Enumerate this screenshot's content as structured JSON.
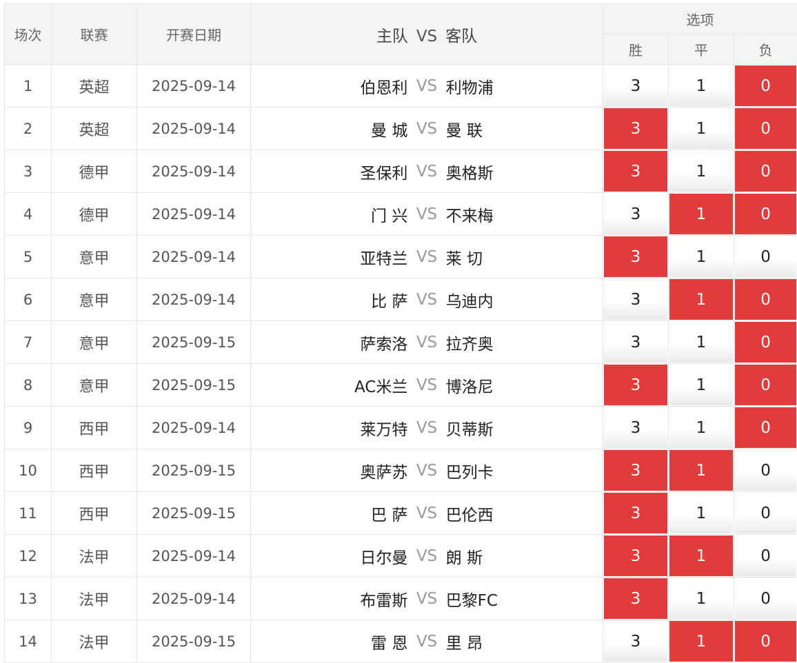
{
  "header": {
    "col_no": "场次",
    "col_league": "联赛",
    "col_date": "开赛日期",
    "col_home": "主队",
    "col_vs": "VS",
    "col_away": "客队",
    "col_options": "选项",
    "opt_win": "胜",
    "opt_draw": "平",
    "opt_lose": "负"
  },
  "vs_text": "VS",
  "colors": {
    "selected": "#e23b3c",
    "header_bg": "#f4f4f4"
  },
  "rows": [
    {
      "no": "1",
      "league": "英超",
      "date": "2025-09-14",
      "home": "伯恩利",
      "away": "利物浦",
      "win": "3",
      "draw": "1",
      "lose": "0",
      "sel": [
        false,
        false,
        true
      ]
    },
    {
      "no": "2",
      "league": "英超",
      "date": "2025-09-14",
      "home": "曼 城",
      "away": "曼 联",
      "win": "3",
      "draw": "1",
      "lose": "0",
      "sel": [
        true,
        false,
        true
      ]
    },
    {
      "no": "3",
      "league": "德甲",
      "date": "2025-09-14",
      "home": "圣保利",
      "away": "奥格斯",
      "win": "3",
      "draw": "1",
      "lose": "0",
      "sel": [
        true,
        false,
        true
      ]
    },
    {
      "no": "4",
      "league": "德甲",
      "date": "2025-09-14",
      "home": "门 兴",
      "away": "不来梅",
      "win": "3",
      "draw": "1",
      "lose": "0",
      "sel": [
        false,
        true,
        true
      ]
    },
    {
      "no": "5",
      "league": "意甲",
      "date": "2025-09-14",
      "home": "亚特兰",
      "away": "莱 切",
      "win": "3",
      "draw": "1",
      "lose": "0",
      "sel": [
        true,
        false,
        false
      ]
    },
    {
      "no": "6",
      "league": "意甲",
      "date": "2025-09-14",
      "home": "比 萨",
      "away": "乌迪内",
      "win": "3",
      "draw": "1",
      "lose": "0",
      "sel": [
        false,
        true,
        true
      ]
    },
    {
      "no": "7",
      "league": "意甲",
      "date": "2025-09-15",
      "home": "萨索洛",
      "away": "拉齐奥",
      "win": "3",
      "draw": "1",
      "lose": "0",
      "sel": [
        false,
        false,
        true
      ]
    },
    {
      "no": "8",
      "league": "意甲",
      "date": "2025-09-15",
      "home": "AC米兰",
      "away": "博洛尼",
      "win": "3",
      "draw": "1",
      "lose": "0",
      "sel": [
        true,
        false,
        true
      ]
    },
    {
      "no": "9",
      "league": "西甲",
      "date": "2025-09-14",
      "home": "莱万特",
      "away": "贝蒂斯",
      "win": "3",
      "draw": "1",
      "lose": "0",
      "sel": [
        false,
        false,
        true
      ]
    },
    {
      "no": "10",
      "league": "西甲",
      "date": "2025-09-15",
      "home": "奥萨苏",
      "away": "巴列卡",
      "win": "3",
      "draw": "1",
      "lose": "0",
      "sel": [
        true,
        true,
        false
      ]
    },
    {
      "no": "11",
      "league": "西甲",
      "date": "2025-09-15",
      "home": "巴 萨",
      "away": "巴伦西",
      "win": "3",
      "draw": "1",
      "lose": "0",
      "sel": [
        true,
        false,
        false
      ]
    },
    {
      "no": "12",
      "league": "法甲",
      "date": "2025-09-14",
      "home": "日尔曼",
      "away": "朗 斯",
      "win": "3",
      "draw": "1",
      "lose": "0",
      "sel": [
        true,
        true,
        false
      ]
    },
    {
      "no": "13",
      "league": "法甲",
      "date": "2025-09-14",
      "home": "布雷斯",
      "away": "巴黎FC",
      "win": "3",
      "draw": "1",
      "lose": "0",
      "sel": [
        true,
        false,
        false
      ]
    },
    {
      "no": "14",
      "league": "法甲",
      "date": "2025-09-15",
      "home": "雷 恩",
      "away": "里 昂",
      "win": "3",
      "draw": "1",
      "lose": "0",
      "sel": [
        false,
        true,
        true
      ]
    }
  ]
}
